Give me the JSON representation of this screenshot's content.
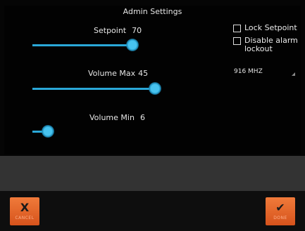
{
  "title": "Admin Settings",
  "sliders": [
    {
      "label": "Setpoint",
      "value": "70",
      "fraction": 1.0
    },
    {
      "label": "Volume Max",
      "value": "45",
      "fraction": 1.0
    },
    {
      "label": "Volume Min",
      "value": "6",
      "fraction": 1.0
    }
  ],
  "options": {
    "lock_setpoint": "Lock Setpoint",
    "disable_alarm_line1": "Disable alarm",
    "disable_alarm_line2": "lockout"
  },
  "frequency": "916 MHZ",
  "buttons": {
    "cancel_glyph": "X",
    "cancel_label": "CANCEL",
    "done_glyph": "✔",
    "done_label": "DONE"
  },
  "colors": {
    "accent": "#2aa8d8",
    "action": "#e8622a"
  }
}
